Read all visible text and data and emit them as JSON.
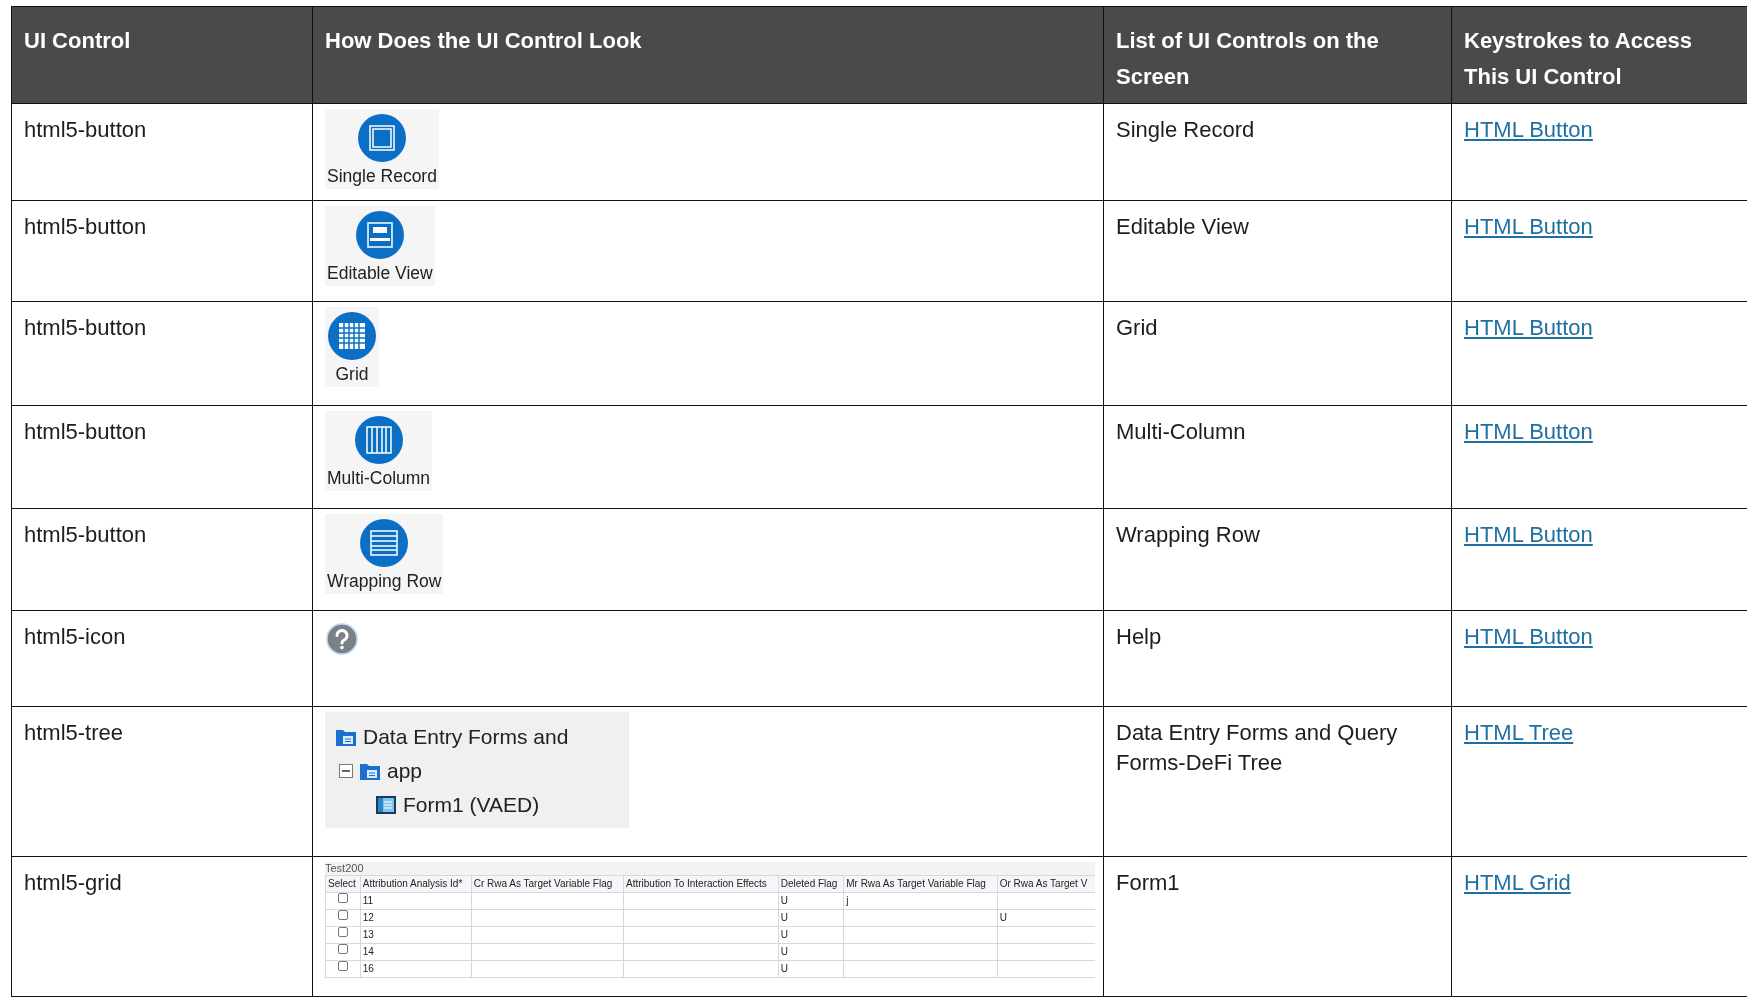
{
  "columns": [
    "UI Control",
    "How Does the UI Control Look",
    "List of UI Controls on the Screen",
    "Keystrokes to Access This UI Control"
  ],
  "rows": [
    {
      "control": "html5-button",
      "look": {
        "kind": "button",
        "label": "Single Record"
      },
      "screen_item": "Single Record",
      "keystroke": "HTML Button"
    },
    {
      "control": "html5-button",
      "look": {
        "kind": "button",
        "label": "Editable View"
      },
      "screen_item": "Editable View",
      "keystroke": "HTML Button"
    },
    {
      "control": "html5-button",
      "look": {
        "kind": "button",
        "label": "Grid"
      },
      "screen_item": "Grid",
      "keystroke": "HTML Button"
    },
    {
      "control": "html5-button",
      "look": {
        "kind": "button",
        "label": "Multi-Column"
      },
      "screen_item": "Multi-Column",
      "keystroke": "HTML Button"
    },
    {
      "control": "html5-button",
      "look": {
        "kind": "button",
        "label": "Wrapping Row"
      },
      "screen_item": "Wrapping Row",
      "keystroke": "HTML Button"
    },
    {
      "control": "html5-icon",
      "look": {
        "kind": "icon"
      },
      "screen_item": "Help",
      "keystroke": "HTML Button"
    },
    {
      "control": "html5-tree",
      "look": {
        "kind": "tree",
        "nodes": [
          {
            "label": "Data Entry Forms and",
            "children": [
              {
                "label": "app",
                "expanded": true,
                "children": [
                  {
                    "label": "Form1 (VAED)"
                  }
                ]
              }
            ]
          }
        ]
      },
      "screen_item": "Data Entry Forms and Query Forms-DeFi Tree",
      "keystroke": "HTML Tree"
    },
    {
      "control": "html5-grid",
      "look": {
        "kind": "grid",
        "title": "Test200",
        "columns": [
          "Select",
          "Attribution Analysis Id*",
          "Cr Rwa As Target Variable Flag",
          "Attribution To Interaction Effects",
          "Deleted Flag",
          "Mr Rwa As Target Variable Flag",
          "Or Rwa As Target V"
        ],
        "rows": [
          {
            "checked": false,
            "cells": [
              "",
              "11",
              "",
              "",
              "U",
              "j",
              ""
            ]
          },
          {
            "checked": false,
            "cells": [
              "",
              "12",
              "",
              "",
              "U",
              "",
              "U"
            ]
          },
          {
            "checked": false,
            "cells": [
              "",
              "13",
              "",
              "",
              "U",
              "",
              ""
            ]
          },
          {
            "checked": false,
            "cells": [
              "",
              "14",
              "",
              "",
              "U",
              "",
              ""
            ]
          },
          {
            "checked": false,
            "cells": [
              "",
              "16",
              "",
              "",
              "U",
              "",
              ""
            ]
          }
        ]
      },
      "screen_item": "Form1",
      "keystroke": "HTML Grid"
    }
  ]
}
